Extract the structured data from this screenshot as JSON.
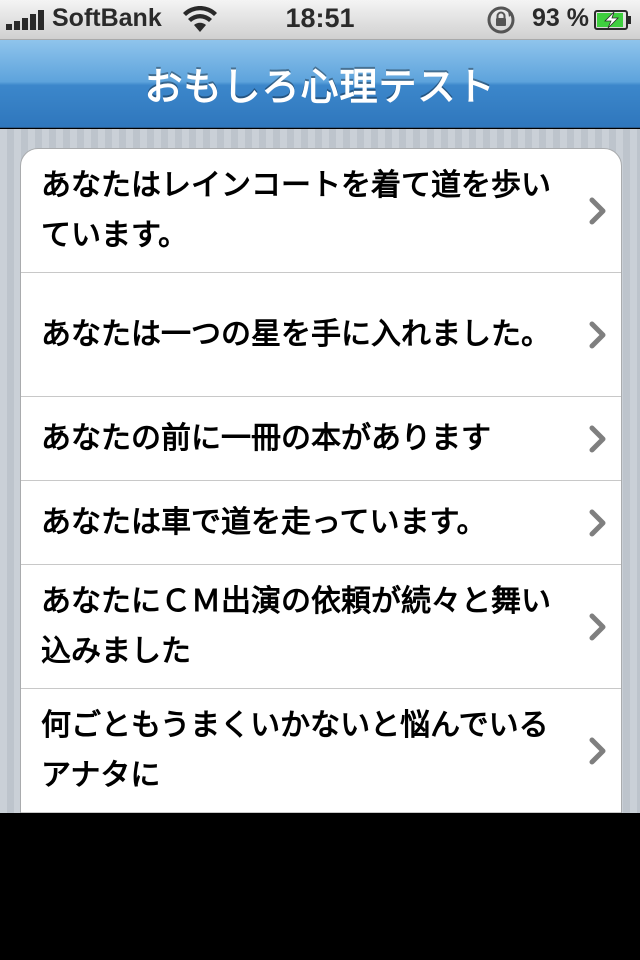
{
  "status_bar": {
    "carrier": "SoftBank",
    "time": "18:51",
    "battery_percent": "93 %",
    "signal_bars": 5,
    "battery_level": 0.93
  },
  "nav": {
    "title": "おもしろ心理テスト"
  },
  "list": {
    "items": [
      {
        "label": "あなたはレインコートを着て道を歩いています。"
      },
      {
        "label": "あなたは一つの星を手に入れました。"
      },
      {
        "label": "あなたの前に一冊の本があります"
      },
      {
        "label": "あなたは車で道を走っています。"
      },
      {
        "label": "あなたにＣＭ出演の依頼が続々と舞い込みました"
      },
      {
        "label": "何ごともうまくいかないと悩んでいるアナタに"
      }
    ]
  },
  "colors": {
    "nav_top": "#8fc4ec",
    "nav_bottom": "#2f77bd",
    "background": "#c5ccd4",
    "chevron": "#7f7f7f",
    "battery_green": "#3fcf3f"
  }
}
